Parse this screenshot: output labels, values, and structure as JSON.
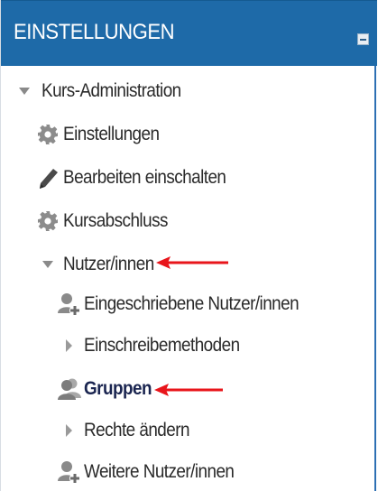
{
  "block": {
    "title": "EINSTELLUNGEN",
    "collapse_icon": "minus-box-icon"
  },
  "tree": {
    "course_admin": {
      "label": "Kurs-Administration",
      "icon": "triangle-down-icon"
    },
    "settings": {
      "label": "Einstellungen",
      "icon": "gear-icon"
    },
    "edit_on": {
      "label": "Bearbeiten einschalten",
      "icon": "pencil-icon"
    },
    "completion": {
      "label": "Kursabschluss",
      "icon": "gear-icon"
    },
    "users": {
      "label": "Nutzer/innen",
      "icon": "triangle-down-icon"
    },
    "enrolled": {
      "label": "Eingeschriebene Nutzer/innen",
      "icon": "user-add-icon"
    },
    "enrol_methods": {
      "label": "Einschreibemethoden",
      "icon": "triangle-right-icon"
    },
    "groups": {
      "label": "Gruppen",
      "icon": "group-icon"
    },
    "permissions": {
      "label": "Rechte ändern",
      "icon": "triangle-right-icon"
    },
    "other_users": {
      "label": "Weitere Nutzer/innen",
      "icon": "user-add-icon"
    }
  },
  "annotation_color": "#e8151b"
}
